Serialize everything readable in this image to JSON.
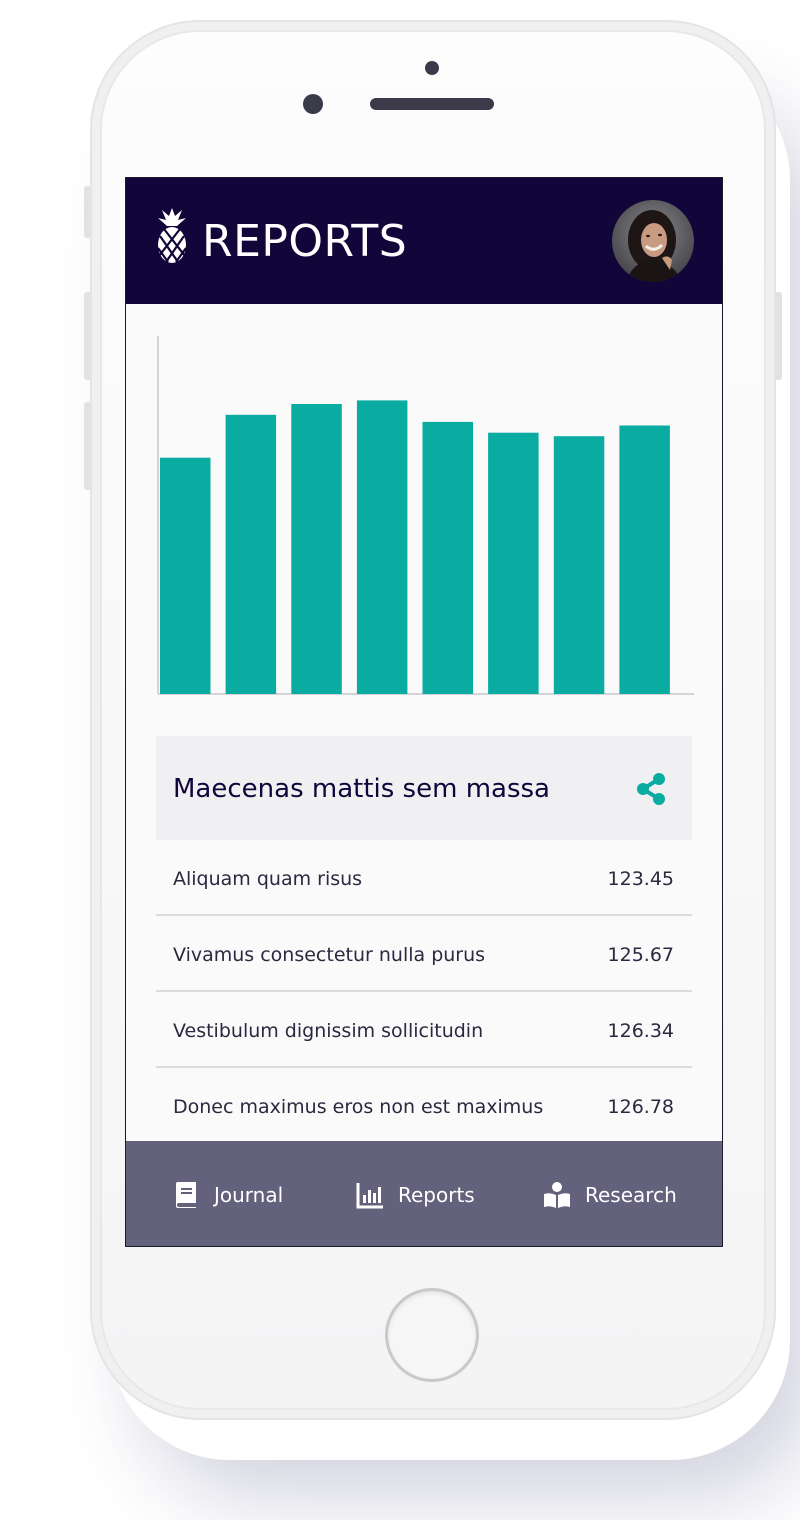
{
  "header": {
    "title": "REPORTS",
    "logo_icon": "pineapple-icon",
    "avatar_icon": "user-avatar"
  },
  "chart_data": {
    "type": "bar",
    "categories": [
      "",
      "",
      "",
      "",
      "",
      "",
      "",
      ""
    ],
    "values": [
      66,
      78,
      81,
      82,
      76,
      73,
      72,
      75
    ],
    "ylim": [
      0,
      100
    ],
    "xlabel": "",
    "ylabel": "",
    "grid": false,
    "color": "#0aaca1"
  },
  "card": {
    "title": "Maecenas mattis sem massa",
    "share_icon": "share-icon",
    "items": [
      {
        "label": "Aliquam quam risus",
        "value": "123.45"
      },
      {
        "label": "Vivamus consectetur nulla purus",
        "value": "125.67"
      },
      {
        "label": "Vestibulum dignissim sollicitudin",
        "value": "126.34"
      },
      {
        "label": "Donec maximus eros non est maximus",
        "value": "126.78"
      }
    ]
  },
  "nav": {
    "items": [
      {
        "label": "Journal",
        "icon": "book-icon"
      },
      {
        "label": "Reports",
        "icon": "bar-chart-icon"
      },
      {
        "label": "Research",
        "icon": "reader-icon"
      }
    ]
  },
  "colors": {
    "header_bg": "#12053a",
    "accent": "#0aaca1",
    "nav_bg": "#63617b",
    "card_header_bg": "#f0f0f2"
  }
}
